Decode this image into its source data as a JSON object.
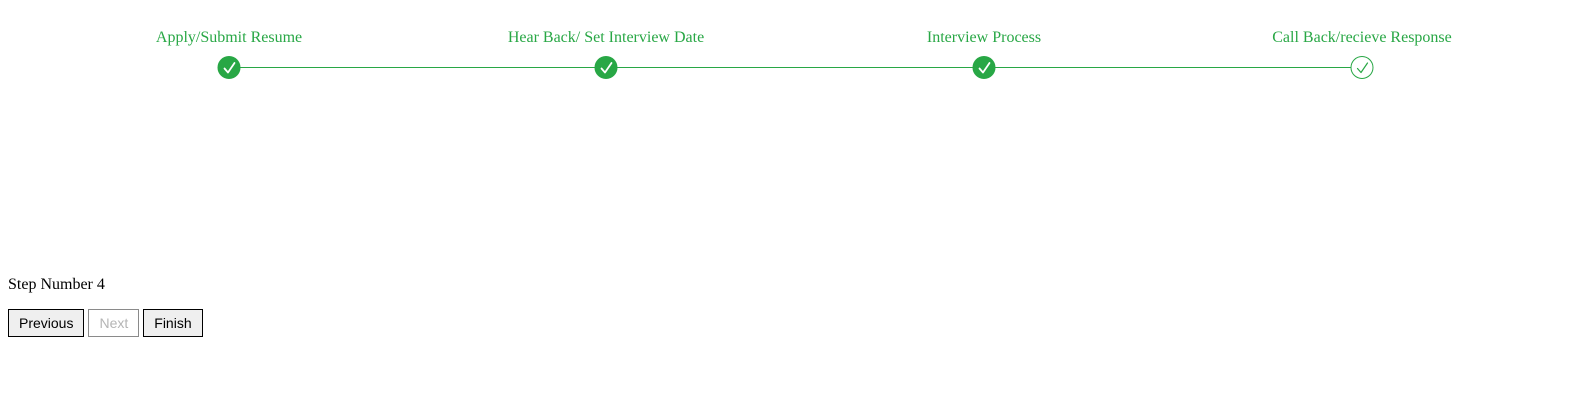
{
  "colors": {
    "accent": "#28a745",
    "text": "#000000",
    "disabled_text": "#b5b5b5",
    "button_bg": "#efefef"
  },
  "stepper": {
    "steps": [
      {
        "label": "Apply/Submit Resume",
        "completed": true,
        "icon": "checkmark-icon"
      },
      {
        "label": "Hear Back/ Set Interview Date",
        "completed": true,
        "icon": "checkmark-icon"
      },
      {
        "label": "Interview Process",
        "completed": true,
        "icon": "checkmark-icon"
      },
      {
        "label": "Call Back/recieve Response",
        "completed": false,
        "icon": "checkmark-outline-icon"
      }
    ]
  },
  "step_info": "Step Number 4",
  "buttons": {
    "previous": {
      "label": "Previous",
      "disabled": false
    },
    "next": {
      "label": "Next",
      "disabled": true
    },
    "finish": {
      "label": "Finish",
      "disabled": false
    }
  }
}
